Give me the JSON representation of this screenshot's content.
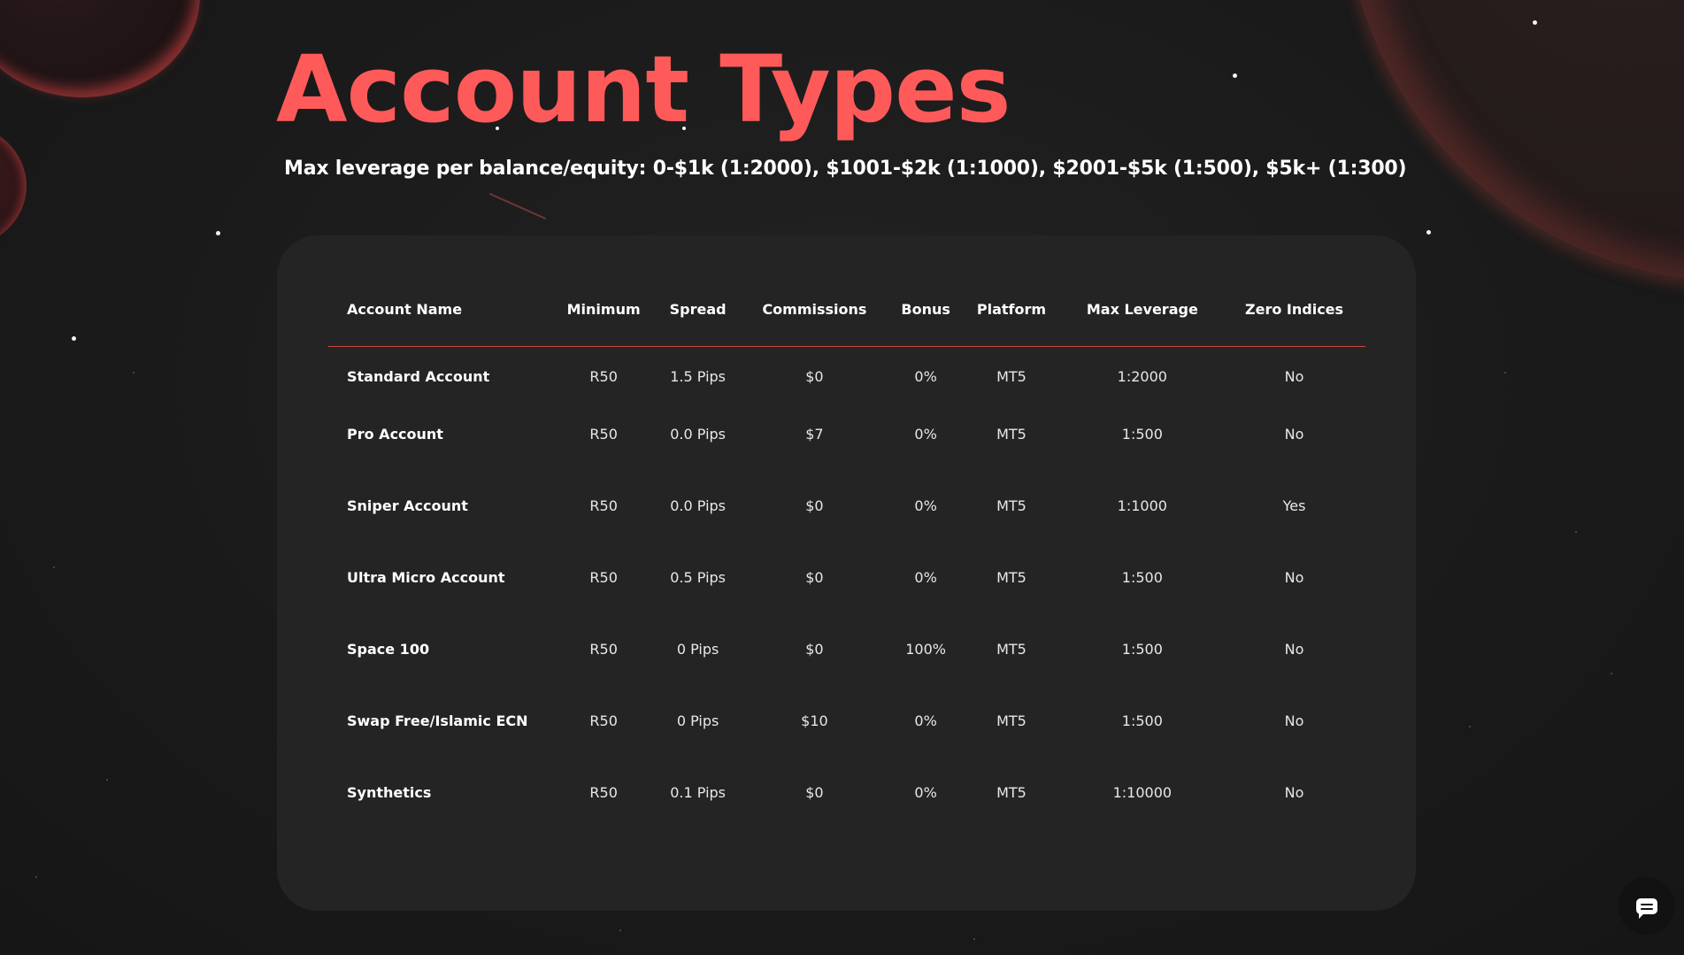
{
  "page": {
    "title": "Account Types",
    "subtitle": "Max leverage per balance/equity: 0-$1k (1:2000), $1001-$2k (1:1000), $2001-$5k (1:500), $5k+ (1:300)"
  },
  "colors": {
    "accent": "#ff5a5a",
    "background": "#1b1b1b",
    "card": "#242424",
    "divider": "#c8463f"
  },
  "table": {
    "headers": [
      "Account Name",
      "Minimum",
      "Spread",
      "Commissions",
      "Bonus",
      "Platform",
      "Max Leverage",
      "Zero Indices"
    ],
    "rows": [
      [
        "Standard Account",
        "R50",
        "1.5 Pips",
        "$0",
        "0%",
        "MT5",
        "1:2000",
        "No"
      ],
      [
        "Pro Account",
        "R50",
        "0.0 Pips",
        "$7",
        "0%",
        "MT5",
        "1:500",
        "No"
      ],
      [
        "Sniper Account",
        "R50",
        "0.0 Pips",
        "$0",
        "0%",
        "MT5",
        "1:1000",
        "Yes"
      ],
      [
        "Ultra Micro Account",
        "R50",
        "0.5 Pips",
        "$0",
        "0%",
        "MT5",
        "1:500",
        "No"
      ],
      [
        "Space 100",
        "R50",
        "0 Pips",
        "$0",
        "100%",
        "MT5",
        "1:500",
        "No"
      ],
      [
        "Swap Free/Islamic ECN",
        "R50",
        "0 Pips",
        "$10",
        "0%",
        "MT5",
        "1:500",
        "No"
      ],
      [
        "Synthetics",
        "R50",
        "0.1 Pips",
        "$0",
        "0%",
        "MT5",
        "1:10000",
        "No"
      ]
    ]
  },
  "chat": {
    "icon": "chat-bubble-icon"
  }
}
